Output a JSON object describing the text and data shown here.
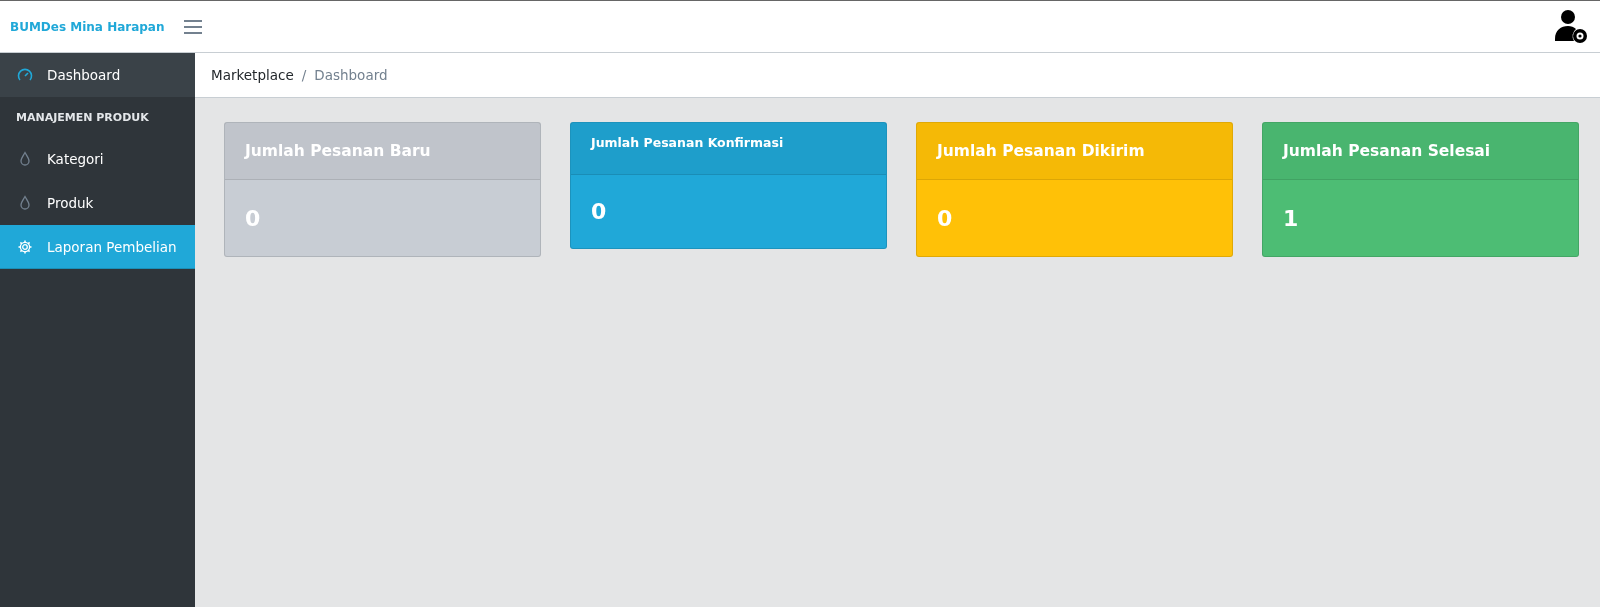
{
  "header": {
    "brand": "BUMDes Mina Harapan"
  },
  "sidebar": {
    "items": [
      {
        "kind": "link",
        "label": "Dashboard",
        "selected": false,
        "highlighted": true
      },
      {
        "kind": "heading",
        "label": "MANAJEMEN PRODUK"
      },
      {
        "kind": "link",
        "label": "Kategori",
        "selected": false,
        "highlighted": false
      },
      {
        "kind": "link",
        "label": "Produk",
        "selected": false,
        "highlighted": false
      },
      {
        "kind": "link",
        "label": "Laporan Pembelian",
        "selected": true,
        "highlighted": false
      }
    ]
  },
  "breadcrumb": {
    "items": [
      "Marketplace",
      "Dashboard"
    ],
    "separator": "/"
  },
  "cards": [
    {
      "kind": "standard",
      "title": "Jumlah Pesanan Baru",
      "value": "0",
      "color": "#c8cdd4"
    },
    {
      "kind": "compact",
      "title": "Jumlah Pesanan Konfirmasi",
      "value": "0",
      "color": "#20a8d8"
    },
    {
      "kind": "standard",
      "title": "Jumlah Pesanan Dikirim",
      "value": "0",
      "color": "#ffc107"
    },
    {
      "kind": "standard",
      "title": "Jumlah Pesanan Selesai",
      "value": "1",
      "color": "#4dbd74"
    }
  ]
}
